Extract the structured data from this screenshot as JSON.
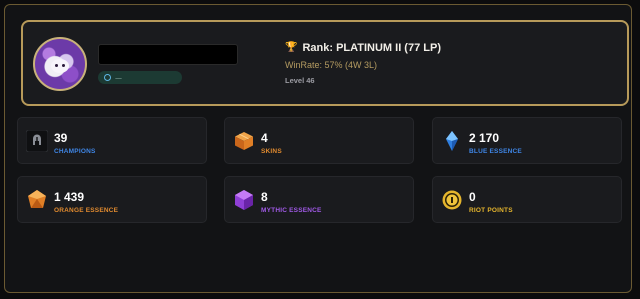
{
  "profile": {
    "region_text": "—",
    "rank_label": "Rank: PLATINUM II (77 LP)",
    "winrate_label": "WinRate: 57% (4W 3L)",
    "level_label": "Level 46"
  },
  "stats": [
    {
      "name": "champions",
      "value": "39",
      "label": "CHAMPIONS",
      "color": "#3f86e6",
      "icon": "helmet-icon"
    },
    {
      "name": "skins",
      "value": "4",
      "label": "SKINS",
      "color": "#e08a2f",
      "icon": "skins-box-icon"
    },
    {
      "name": "blue-essence",
      "value": "2 170",
      "label": "BLUE ESSENCE",
      "color": "#3f86e6",
      "icon": "blue-essence-icon"
    },
    {
      "name": "orange-essence",
      "value": "1 439",
      "label": "ORANGE ESSENCE",
      "color": "#e08a2f",
      "icon": "orange-essence-icon"
    },
    {
      "name": "mythic-essence",
      "value": "8",
      "label": "MYTHIC ESSENCE",
      "color": "#a05ae6",
      "icon": "mythic-essence-icon"
    },
    {
      "name": "riot-points",
      "value": "0",
      "label": "RIOT POINTS",
      "color": "#e5b52d",
      "icon": "riot-points-icon"
    }
  ],
  "colors": {
    "accent_gold": "#b79a5a",
    "background": "#121315",
    "card": "#1a1b1e"
  }
}
